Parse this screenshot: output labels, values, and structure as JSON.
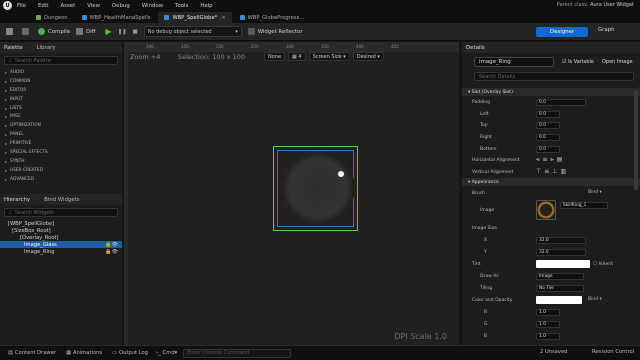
{
  "menubar": {
    "items": [
      "File",
      "Edit",
      "Asset",
      "View",
      "Debug",
      "Window",
      "Tools",
      "Help"
    ],
    "parent_class_label": "Parent class:",
    "parent_class_value": "Aura User Widget"
  },
  "tabs": [
    {
      "label": "Dungeon"
    },
    {
      "label": "WBP_HealthManaSpells"
    },
    {
      "label": "WBP_SpellGlobe*"
    },
    {
      "label": "WBP_GlobeProgress..."
    }
  ],
  "toolbar": {
    "compile": "Compile",
    "diff": "Diff",
    "debug_placeholder": "No debug object selected",
    "widget_reflector": "Widget Reflector",
    "designer": "Designer",
    "graph": "Graph"
  },
  "palette": {
    "title": "Palette",
    "library": "Library",
    "search_placeholder": "Search Palette",
    "categories": [
      "AUDIO",
      "COMMON",
      "EDITOR",
      "INPUT",
      "LISTS",
      "MISC",
      "OPTIMIZATION",
      "PANEL",
      "PRIMITIVE",
      "SPECIAL EFFECTS",
      "SYNTH",
      "USER CREATED",
      "ADVANCED"
    ]
  },
  "hierarchy": {
    "title": "Hierarchy",
    "bind": "Bind Widgets",
    "search_placeholder": "Search Widgets",
    "items": [
      "[WBP_SpellGlobe]",
      "[SizeBox_Root]",
      "[Overlay_Root]",
      "Image_Glass",
      "Image_Ring"
    ]
  },
  "canvas": {
    "zoom": "Zoom +4",
    "selection": "Selection: 100 x 100",
    "none": "None",
    "step": "4",
    "screen_size": "Screen Size",
    "desired": "Desired",
    "dpi": "DPI Scale 1.0",
    "ruler": [
      "100",
      "150",
      "200",
      "250",
      "300",
      "350",
      "400",
      "450"
    ]
  },
  "details": {
    "title": "Details",
    "name": "Image_Ring",
    "is_variable": "Is Variable",
    "open_image": "Open Image",
    "search_placeholder": "Search Details",
    "slot_section": "Slot (Overlay Slot)",
    "padding": "Padding",
    "padding_values": {
      "total": "0.0",
      "left": "0.0",
      "top": "0.0",
      "right": "0.0",
      "bottom": "0.0"
    },
    "left": "Left",
    "top": "Top",
    "right": "Right",
    "bottom": "Bottom",
    "halign": "Horizontal Alignment",
    "valign": "Vertical Alignment",
    "appearance": "Appearance",
    "brush": "Brush",
    "image": "Image",
    "image_asset": "SkillRing_1",
    "bind": "Bind",
    "image_size": "Image Size",
    "x": "X",
    "y": "Y",
    "x_val": "32.0",
    "y_val": "32.0",
    "tint": "Tint",
    "inherit": "Inherit",
    "draw_as": "Draw As",
    "draw_as_val": "Image",
    "tiling": "Tiling",
    "tiling_val": "No Tile",
    "color_opacity": "Color and Opacity",
    "r": "R",
    "g": "G",
    "b": "B",
    "r_val": "1.0",
    "g_val": "1.0",
    "b_val": "1.0"
  },
  "status": {
    "content_drawer": "Content Drawer",
    "animations": "Animations",
    "output_log": "Output Log",
    "cmd": "Cmd",
    "cmd_placeholder": "Enter Console Command",
    "unsaved": "2 Unsaved",
    "revision": "Revision Control"
  }
}
